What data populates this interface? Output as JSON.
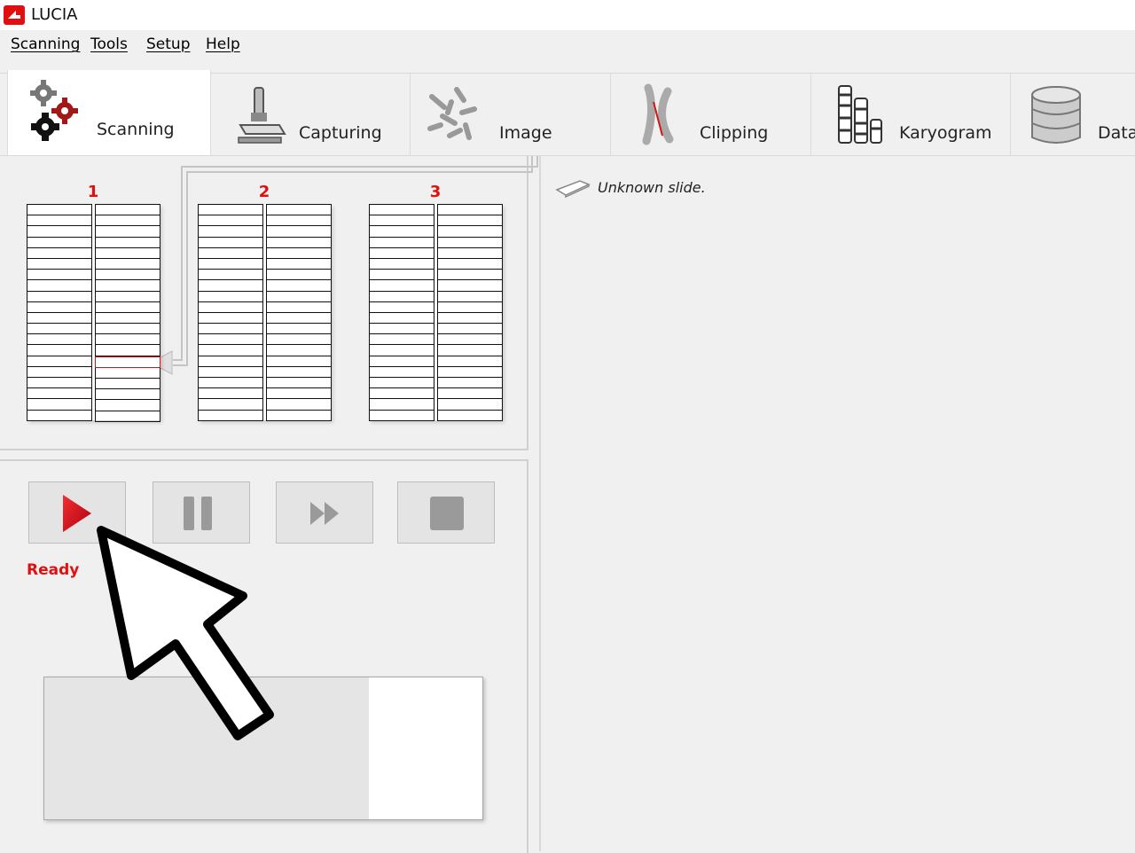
{
  "app": {
    "title": "LUCIA",
    "logo_icon": "lucia-logo-icon",
    "brand_color": "#e01010"
  },
  "menu": [
    {
      "label": "Scanning"
    },
    {
      "label": "Tools"
    },
    {
      "label": "Setup"
    },
    {
      "label": "Help"
    }
  ],
  "ribbon": {
    "tabs": [
      {
        "label": "Scanning",
        "icon": "gears-icon",
        "active": true
      },
      {
        "label": "Capturing",
        "icon": "microscope-icon"
      },
      {
        "label": "Image",
        "icon": "chromosomes-icon"
      },
      {
        "label": "Clipping",
        "icon": "chromosome-clip-icon"
      },
      {
        "label": "Karyogram",
        "icon": "karyogram-icon"
      },
      {
        "label": "Data",
        "icon": "database-icon"
      }
    ]
  },
  "racks": [
    {
      "number": "1"
    },
    {
      "number": "2"
    },
    {
      "number": "3"
    }
  ],
  "controls": {
    "play_icon": "play-icon",
    "pause_icon": "pause-icon",
    "skip_icon": "fast-forward-icon",
    "stop_icon": "stop-icon",
    "status": "Ready"
  },
  "progress": {
    "value_percent": 74
  },
  "slide_info": {
    "text": "Unknown slide.",
    "icon": "slide-icon"
  }
}
